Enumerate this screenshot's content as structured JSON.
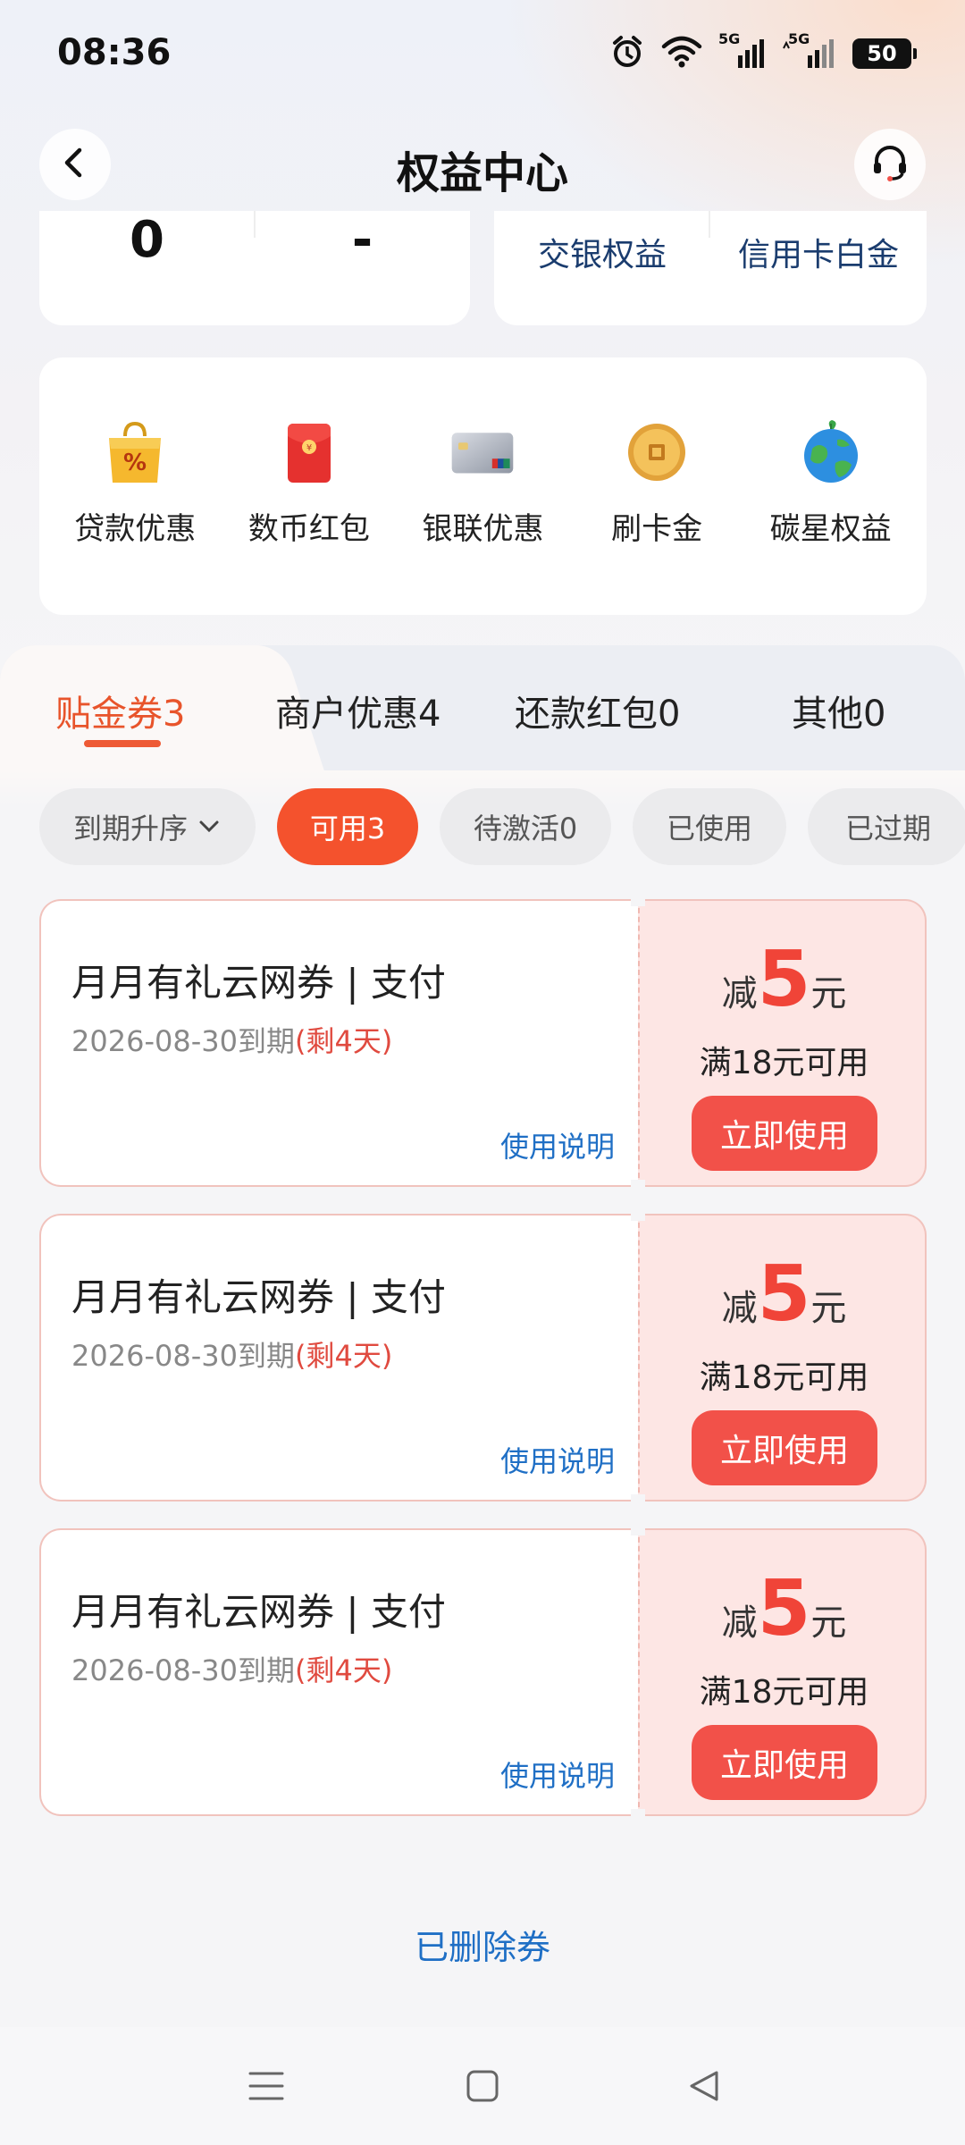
{
  "status_bar": {
    "time": "08:36",
    "signal1_label": "5G",
    "signal2_label": "5G",
    "battery": "50",
    "icons": [
      "alarm-icon",
      "wifi-icon",
      "signal-icon",
      "signal-icon",
      "battery-icon"
    ]
  },
  "header": {
    "title": "权益中心",
    "back_icon": "chevron-left-icon",
    "service_icon": "headset-icon"
  },
  "stats": {
    "left_value": "0",
    "right_value": "-"
  },
  "quick_links": {
    "items": [
      "交银权益",
      "信用卡白金"
    ]
  },
  "benefits": {
    "items": [
      {
        "label": "贷款优惠",
        "icon": "shopping-bag-percent-icon"
      },
      {
        "label": "数币红包",
        "icon": "red-envelope-icon"
      },
      {
        "label": "银联优惠",
        "icon": "unionpay-card-icon"
      },
      {
        "label": "刷卡金",
        "icon": "gold-coin-icon"
      },
      {
        "label": "碳星权益",
        "icon": "earth-icon"
      }
    ]
  },
  "tabs": {
    "items": [
      "贴金券3",
      "商户优惠4",
      "还款红包0",
      "其他0"
    ],
    "active_index": 0
  },
  "filters": {
    "sort_label": "到期升序",
    "chips": [
      "可用3",
      "待激活0",
      "已使用",
      "已过期"
    ],
    "active_index": 0
  },
  "coupons": [
    {
      "title": "月月有礼云网券 | 支付",
      "expiry": "2026-08-30到期",
      "remaining": "(剩4天)",
      "instructions": "使用说明",
      "amount_prefix": "减",
      "amount": "5",
      "amount_unit": "元",
      "threshold": "满18元可用",
      "button": "立即使用"
    },
    {
      "title": "月月有礼云网券 | 支付",
      "expiry": "2026-08-30到期",
      "remaining": "(剩4天)",
      "instructions": "使用说明",
      "amount_prefix": "减",
      "amount": "5",
      "amount_unit": "元",
      "threshold": "满18元可用",
      "button": "立即使用"
    },
    {
      "title": "月月有礼云网券 | 支付",
      "expiry": "2026-08-30到期",
      "remaining": "(剩4天)",
      "instructions": "使用说明",
      "amount_prefix": "减",
      "amount": "5",
      "amount_unit": "元",
      "threshold": "满18元可用",
      "button": "立即使用"
    }
  ],
  "footer": {
    "deleted_link": "已删除券"
  },
  "nav_bar": {
    "icons": [
      "menu-icon",
      "home-square-icon",
      "back-triangle-icon"
    ]
  },
  "colors": {
    "accent": "#ee5a35",
    "chip_active": "#f4522d",
    "coupon_red": "#f04438",
    "link_blue": "#1f6fc5"
  }
}
